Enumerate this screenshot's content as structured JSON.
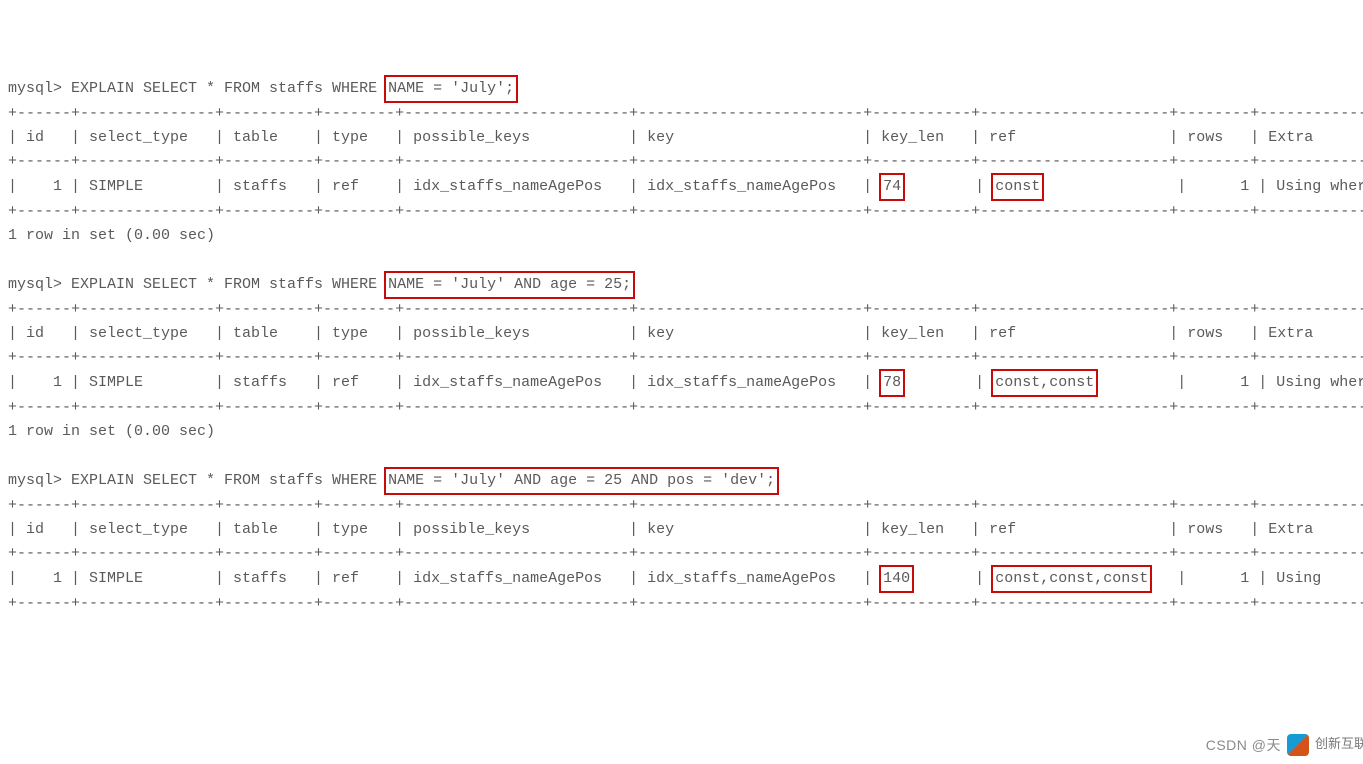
{
  "blocks": [
    {
      "prompt": "mysql> ",
      "sql_pre": "EXPLAIN SELECT * FROM staffs WHERE ",
      "sql_box": "NAME = 'July';",
      "sql_post": "",
      "headers": [
        "id",
        "select_type",
        "table",
        "type",
        "possible_keys",
        "key",
        "key_len",
        "ref",
        "rows",
        "Extra"
      ],
      "row": {
        "id": "1",
        "select_type": "SIMPLE",
        "table": "staffs",
        "type": "ref",
        "possible_keys": "idx_staffs_nameAgePos",
        "key": "idx_staffs_nameAgePos",
        "key_len": "74",
        "ref": "const",
        "rows": "1",
        "Extra": "Using where"
      },
      "footer": "1 row in set (0.00 sec)"
    },
    {
      "prompt": "mysql> ",
      "sql_pre": "EXPLAIN SELECT * FROM staffs WHERE ",
      "sql_box": "NAME = 'July' AND age = 25;",
      "sql_post": "",
      "headers": [
        "id",
        "select_type",
        "table",
        "type",
        "possible_keys",
        "key",
        "key_len",
        "ref",
        "rows",
        "Extra"
      ],
      "row": {
        "id": "1",
        "select_type": "SIMPLE",
        "table": "staffs",
        "type": "ref",
        "possible_keys": "idx_staffs_nameAgePos",
        "key": "idx_staffs_nameAgePos",
        "key_len": "78",
        "ref": "const,const",
        "rows": "1",
        "Extra": "Using where"
      },
      "footer": "1 row in set (0.00 sec)"
    },
    {
      "prompt": "mysql> ",
      "sql_pre": "EXPLAIN SELECT * FROM staffs WHERE ",
      "sql_box": "NAME = 'July' AND age = 25 AND pos = 'dev';",
      "sql_post": "",
      "headers": [
        "id",
        "select_type",
        "table",
        "type",
        "possible_keys",
        "key",
        "key_len",
        "ref",
        "rows",
        "Extra"
      ],
      "row": {
        "id": "1",
        "select_type": "SIMPLE",
        "table": "staffs",
        "type": "ref",
        "possible_keys": "idx_staffs_nameAgePos",
        "key": "idx_staffs_nameAgePos",
        "key_len": "140",
        "ref": "const,const,const",
        "rows": "1",
        "Extra": "Using"
      },
      "footer": ""
    }
  ],
  "col_widths": {
    "id": 4,
    "select_type": 13,
    "table": 8,
    "type": 6,
    "possible_keys": 23,
    "key": 23,
    "key_len": 9,
    "ref": 19,
    "rows": 6,
    "Extra": 13
  },
  "watermark": {
    "left": "CSDN @天",
    "right": "创新互联"
  }
}
